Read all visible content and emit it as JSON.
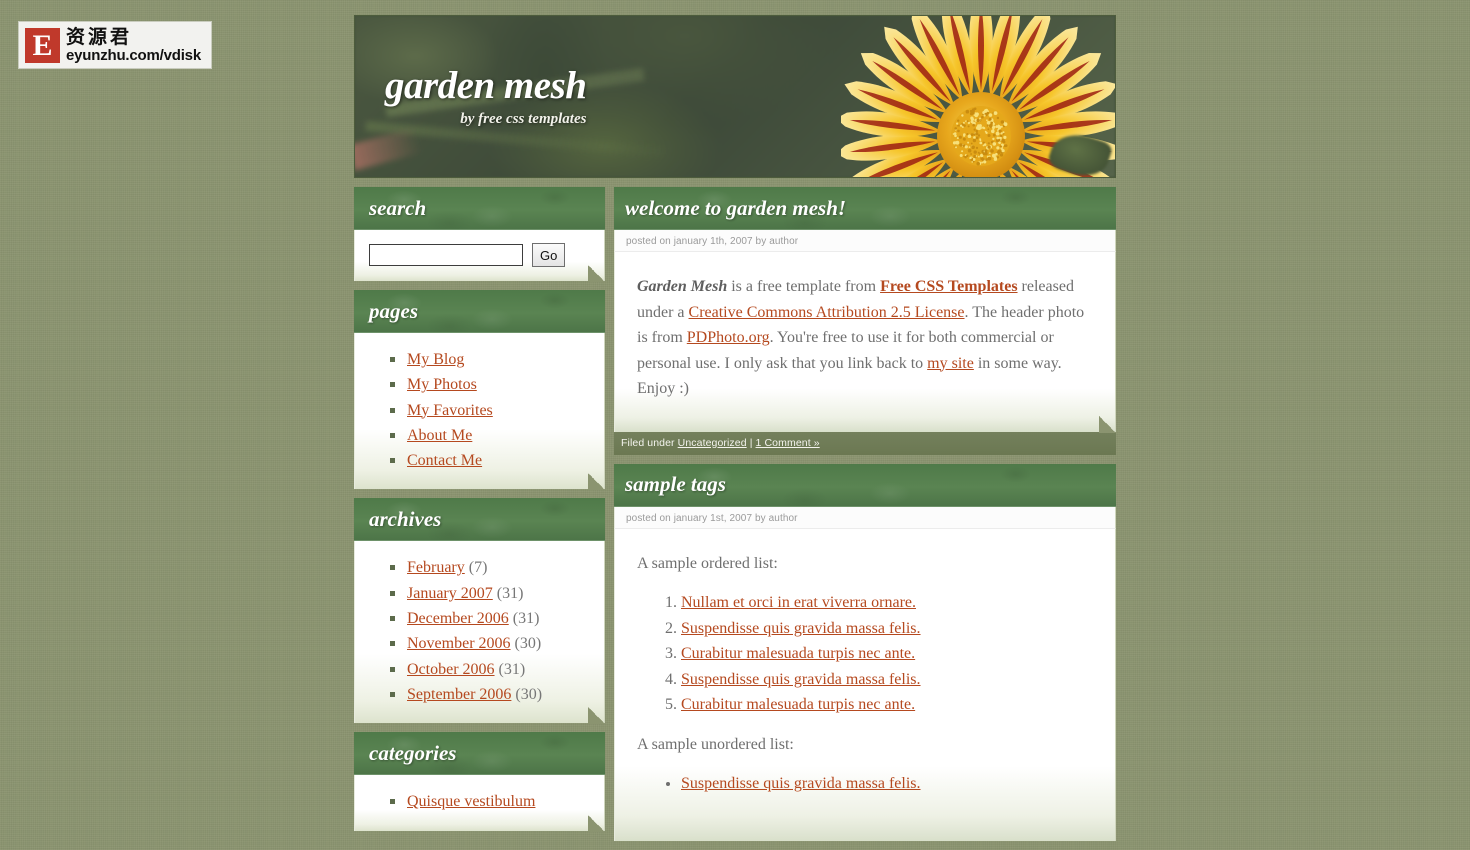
{
  "watermark": {
    "letter": "E",
    "chinese": "资源君",
    "url": "eyunzhu.com/vdisk"
  },
  "header": {
    "title": "garden mesh",
    "tagline": "by free css templates"
  },
  "sidebar": {
    "search": {
      "heading": "search",
      "value": "",
      "placeholder": "",
      "button_label": "Go"
    },
    "pages": {
      "heading": "pages",
      "items": [
        {
          "label": "My Blog"
        },
        {
          "label": "My Photos"
        },
        {
          "label": "My Favorites"
        },
        {
          "label": "About Me"
        },
        {
          "label": "Contact Me"
        }
      ]
    },
    "archives": {
      "heading": "archives",
      "items": [
        {
          "label": "February",
          "count": "(7)"
        },
        {
          "label": "January 2007",
          "count": "(31)"
        },
        {
          "label": "December 2006",
          "count": "(31)"
        },
        {
          "label": "November 2006",
          "count": "(30)"
        },
        {
          "label": "October 2006",
          "count": "(31)"
        },
        {
          "label": "September 2006",
          "count": "(30)"
        }
      ]
    },
    "categories": {
      "heading": "categories",
      "items": [
        {
          "label": "Quisque vestibulum"
        }
      ]
    }
  },
  "posts": {
    "welcome": {
      "title": "welcome to garden mesh!",
      "meta": "posted on january 1th, 2007 by author",
      "body": {
        "lead_em": "Garden Mesh",
        "t1": " is a free template from ",
        "link_fct": "Free CSS Templates",
        "t2": " released under a ",
        "link_cc": "Creative Commons Attribution 2.5 License",
        "t3": ". The header photo is from ",
        "link_pd": "PDPhoto.org",
        "t4": ". You're free to use it for both commercial or personal use. I only ask that you link back to ",
        "link_site": "my site",
        "t5": " in some way. Enjoy :)"
      },
      "footer": {
        "filed_under": "Filed under ",
        "category": "Uncategorized",
        "separator": " | ",
        "comments": "1 Comment »"
      }
    },
    "sample_tags": {
      "title": "sample tags",
      "meta": "posted on january 1st, 2007 by author",
      "ordered_intro": "A sample ordered list:",
      "ordered_items": [
        "Nullam et orci in erat viverra ornare.",
        "Suspendisse quis gravida massa felis.",
        "Curabitur malesuada turpis nec ante.",
        "Suspendisse quis gravida massa felis.",
        "Curabitur malesuada turpis nec ante."
      ],
      "unordered_intro": "A sample unordered list:",
      "unordered_items": [
        "Suspendisse quis gravida massa felis."
      ]
    }
  }
}
